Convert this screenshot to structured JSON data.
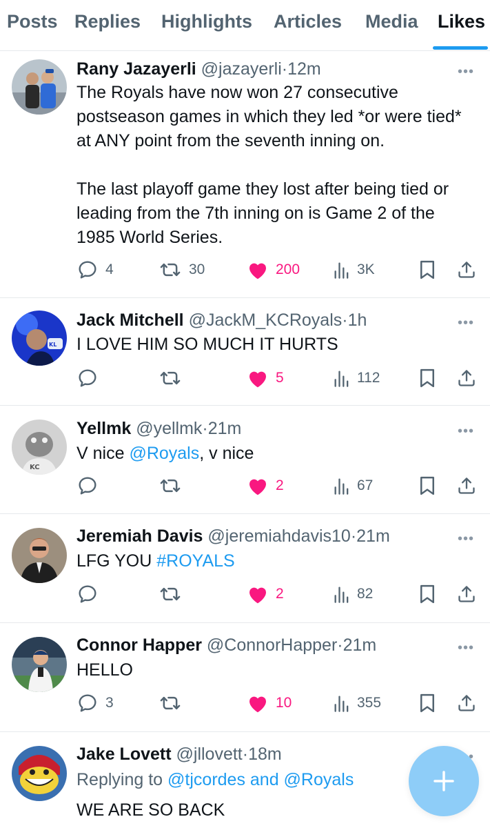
{
  "tabs": [
    {
      "label": "Posts"
    },
    {
      "label": "Replies"
    },
    {
      "label": "Highlights"
    },
    {
      "label": "Articles"
    },
    {
      "label": "Media"
    },
    {
      "label": "Likes",
      "active": true
    }
  ],
  "colors": {
    "accent": "#1d9bf0",
    "like": "#f91880",
    "muted": "#536471",
    "fab": "#8ecdf8"
  },
  "more_label": "•••",
  "tweets": [
    {
      "name": "Rany Jazayerli",
      "handle": "@jazayerli",
      "sep": "·",
      "time": "12m",
      "text": "The Royals have now won 27 consecutive postseason games in which they led *or were tied* at ANY point from the seventh inning on.\n\nThe last playoff game they lost after being tied or leading from the 7th inning on is Game 2 of the 1985 World Series.",
      "replies": "4",
      "reposts": "30",
      "likes": "200",
      "views": "3K"
    },
    {
      "name": "Jack Mitchell",
      "handle": "@JackM_KCRoyals",
      "sep": "·",
      "time": "1h",
      "text": "I LOVE HIM SO MUCH IT HURTS",
      "replies": "",
      "reposts": "",
      "likes": "5",
      "views": "112"
    },
    {
      "name": "Yellmk",
      "handle": "@yellmk",
      "sep": "·",
      "time": "21m",
      "text_pre": "V nice ",
      "mention": "@Royals",
      "text_post": ", v nice",
      "replies": "",
      "reposts": "",
      "likes": "2",
      "views": "67"
    },
    {
      "name": "Jeremiah Davis",
      "handle": "@jeremiahdavis10",
      "sep": "·",
      "time": "21m",
      "text_pre": "LFG YOU ",
      "hashtag": "#ROYALS",
      "replies": "",
      "reposts": "",
      "likes": "2",
      "views": "82"
    },
    {
      "name": "Connor Happer",
      "handle": "@ConnorHapper",
      "sep": "·",
      "time": "21m",
      "text": "HELLO",
      "replies": "3",
      "reposts": "",
      "likes": "10",
      "views": "355"
    },
    {
      "name": "Jake Lovett",
      "handle": "@jllovett",
      "sep": "·",
      "time": "18m",
      "replying_prefix": "Replying to ",
      "replying_to": "@tjcordes and @Royals",
      "text": "WE ARE SO BACK"
    }
  ],
  "fab_icon": "plus-icon"
}
